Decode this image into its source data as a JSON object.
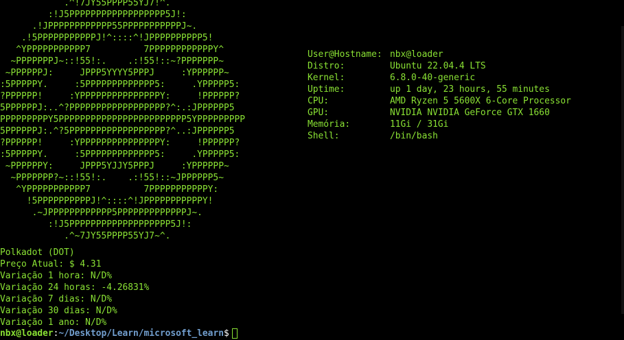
{
  "ascii_art": [
    "            .^!7JY55PPPP55YJ7!^.",
    "         :!J5PPPPPPPPPPPPPPPPPP5J!:",
    "      .!JPPPPPPPPPPPP55PPPPPPPPPPPJ~.",
    "    .!5PPPPPPPPPPPJ!^::::^!JPPPPPPPPPP5!",
    "   ^YPPPPPPPPPPP7          7PPPPPPPPPPPPY^",
    "  ~PPPPPPPJ~::!55!:.    .:!55!::~?PPPPPPP~",
    " ~PPPPPPJ:     JPPP5YYYY5PPPJ     :YPPPPPP~",
    ":5PPPPPY.     :5PPPPPPPPPPPPP5:     .YPPPPP5:",
    "?PPPPPP!     :YPPPPPPPPPPPPPPPY:     !PPPPPP?",
    "5PPPPPPJ:..^?PPPPPPPPPPPPPPPPPP?^:.:JPPPPPP5",
    "PPPPPPPPPY5PPPPPPPPPPPPPPPPPPPPPPPP5YPPPPPPPPP",
    "5PPPPPPJ:.^?5PPPPPPPPPPPPPPPPPP?^..:JPPPPPP5",
    "?PPPPPP!     :YPPPPPPPPPPPPPPPY:     !PPPPPP?",
    ":5PPPPPY.     :5PPPPPPPPPPPPP5:     .YPPPPP5:",
    " ~PPPPPPY:     JPPP5YJJY5PPPJ     :YPPPPPP~",
    "  ~PPPPPPP?~::!55!:.    .:!55!::~JPPPPPP5~",
    "   ^YPPPPPPPPPPP7          7PPPPPPPPPPPY:",
    "     !5PPPPPPPPPPJ!^::::^!JPPPPPPPPPPPY!",
    "      .~JPPPPPPPPPPPP5PPPPPPPPPPPPPJ~.",
    "         :!J5PPPPPPPPPPPPPPPPPPP5J!:",
    "            .^~7JY55PPPP55YJ7~^."
  ],
  "system_info": [
    {
      "key": "User@Hostname:",
      "value": "nbx@loader"
    },
    {
      "key": "Distro:",
      "value": "Ubuntu 22.04.4 LTS"
    },
    {
      "key": "Kernel:",
      "value": "6.8.0-40-generic"
    },
    {
      "key": "Uptime:",
      "value": "up 1 day, 23 hours, 55 minutes"
    },
    {
      "key": "CPU:",
      "value": "AMD Ryzen 5 5600X 6-Core Processor"
    },
    {
      "key": "GPU:",
      "value": "NVIDIA NVIDIA GeForce GTX 1660"
    },
    {
      "key": "Memória:",
      "value": "11Gi / 31Gi"
    },
    {
      "key": "Shell:",
      "value": "/bin/bash"
    }
  ],
  "coin_info": [
    "Polkadot (DOT)",
    "Preço Atual: $ 4.31",
    "Variação 1 hora: N/D%",
    "Variação 24 horas: -4.26831%",
    "Variação 7 dias: N/D%",
    "Variação 30 dias: N/D%",
    "Variação 1 ano: N/D%"
  ],
  "prompt": {
    "user": "nbx@loader",
    "sep": ":",
    "path": "~/Desktop/Learn/microsoft_learn",
    "dollar": "$"
  },
  "colors": {
    "background": "#000000",
    "text_green": "#8ae234",
    "path_blue": "#729fcf"
  }
}
